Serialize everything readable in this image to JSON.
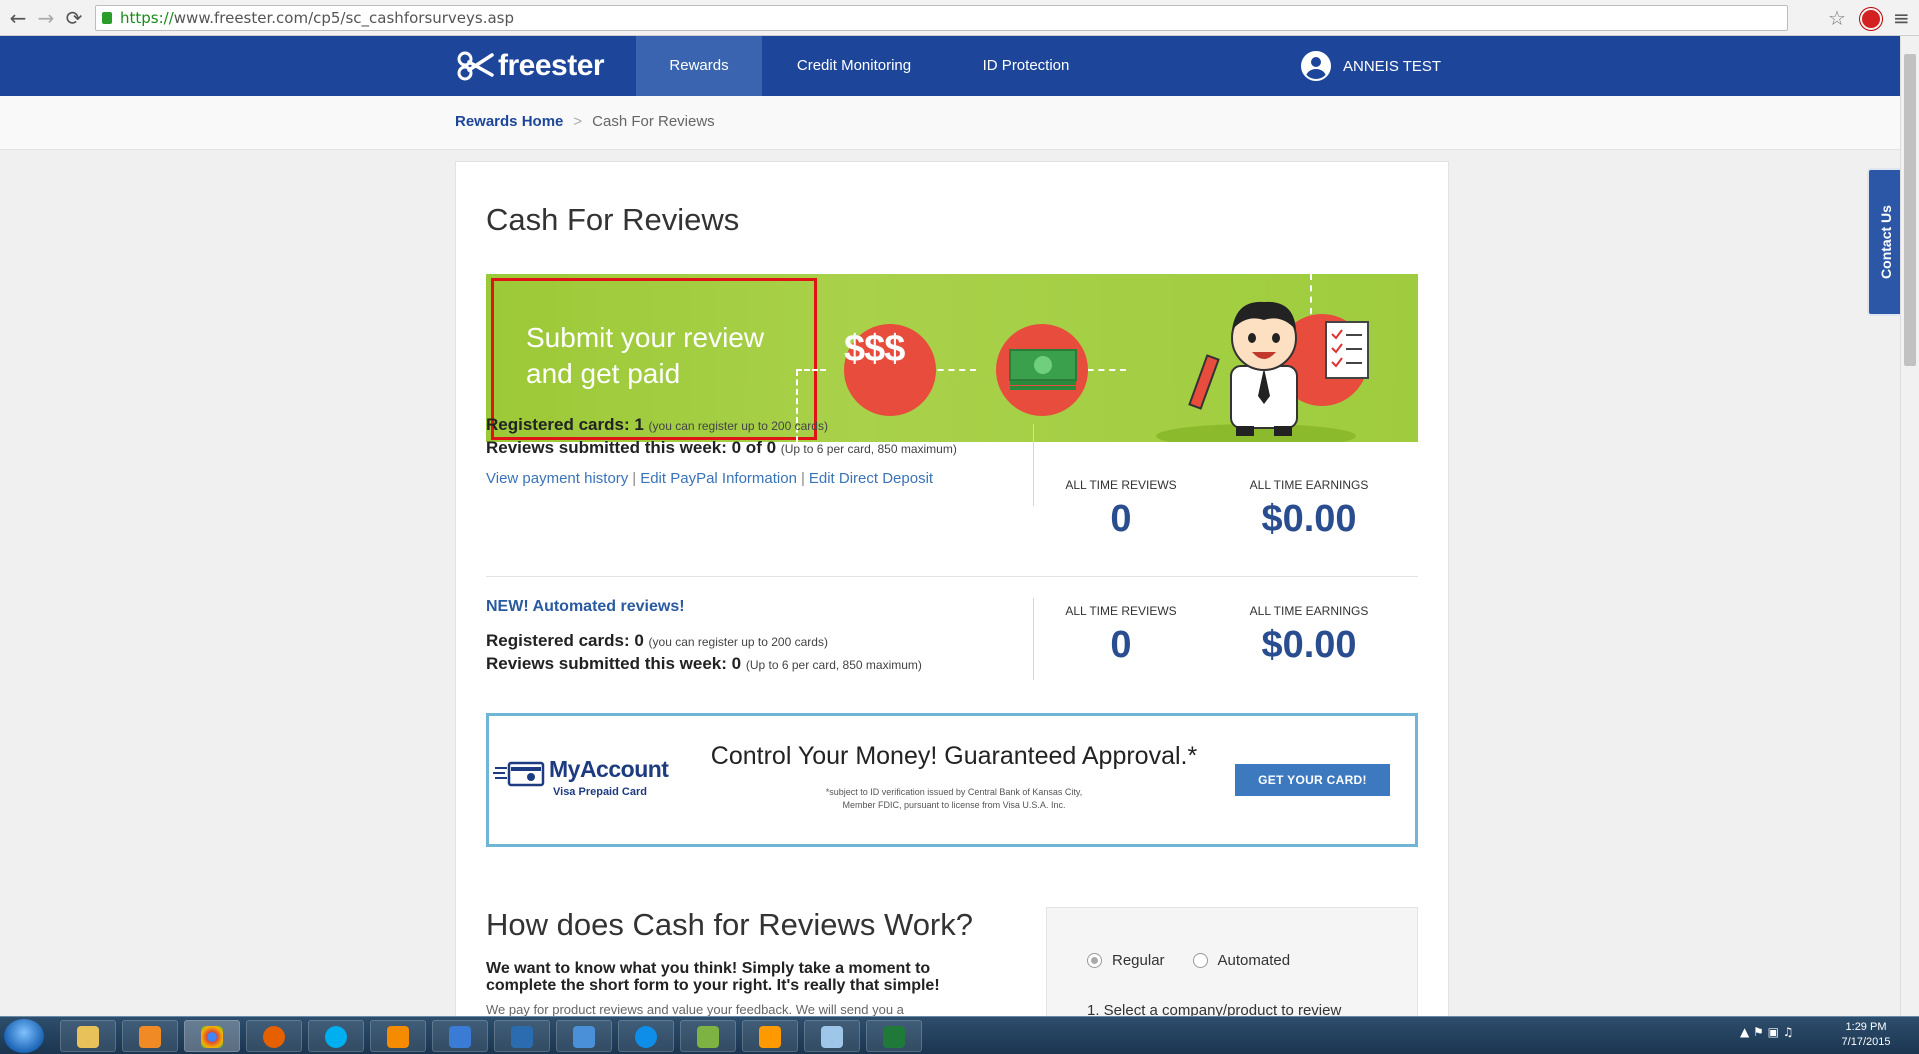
{
  "browser": {
    "url_scheme": "https://",
    "url_rest": "www.freester.com/cp5/sc_cashforsurveys.asp",
    "back_icon": "←",
    "forward_icon": "→",
    "reload_icon": "⟳",
    "star_icon": "☆",
    "menu_icon": "≡"
  },
  "header": {
    "logo": "freester",
    "nav": [
      "Rewards",
      "Credit Monitoring",
      "ID Protection"
    ],
    "user_name": "ANNEIS TEST"
  },
  "breadcrumb": {
    "home": "Rewards Home",
    "separator": ">",
    "current": "Cash For Reviews"
  },
  "page": {
    "title": "Cash For Reviews",
    "banner_line1": "Submit your review",
    "banner_line2": "and get paid",
    "banner_dollars": "$$$"
  },
  "manual": {
    "registered_label": "Registered cards: 1",
    "registered_note": "(you can register up to 200 cards)",
    "submitted_label": "Reviews submitted this week: 0 of 0",
    "submitted_note": "(Up to 6 per card, 850 maximum)",
    "links": [
      "View payment history",
      "Edit PayPal Information",
      "Edit Direct Deposit"
    ],
    "link_sep": "|",
    "reviews_label": "ALL TIME REVIEWS",
    "reviews_value": "0",
    "earnings_label": "ALL TIME EARNINGS",
    "earnings_value": "$0.00"
  },
  "automated": {
    "heading": "NEW! Automated reviews!",
    "registered_label": "Registered cards: 0",
    "registered_note": "(you can register up to 200 cards)",
    "submitted_label": "Reviews submitted this week: 0",
    "submitted_note": "(Up to 6 per card, 850 maximum)",
    "reviews_label": "ALL TIME REVIEWS",
    "reviews_value": "0",
    "earnings_label": "ALL TIME EARNINGS",
    "earnings_value": "$0.00"
  },
  "ad": {
    "brand": "MyAccount",
    "brand_sub": "Visa Prepaid Card",
    "headline": "Control Your Money! Guaranteed Approval.*",
    "fine_print": "*subject to ID verification issued by Central Bank of Kansas City, Member FDIC, pursuant to license from Visa U.S.A. Inc.",
    "button": "GET YOUR CARD!"
  },
  "how": {
    "title": "How does Cash for Reviews Work?",
    "intro": "We want to know what you think! Simply take a moment to complete the short form to your right. It's really that simple!",
    "body": "We pay for product reviews and value your feedback. We will send you a",
    "radio_regular": "Regular",
    "radio_automated": "Automated",
    "step1": "1. Select a company/product to review"
  },
  "contact_tab": "Contact Us",
  "taskbar": {
    "time": "1:29 PM",
    "date": "7/17/2015",
    "tray_icons": "▲ ⚑ ▣ ♫"
  }
}
